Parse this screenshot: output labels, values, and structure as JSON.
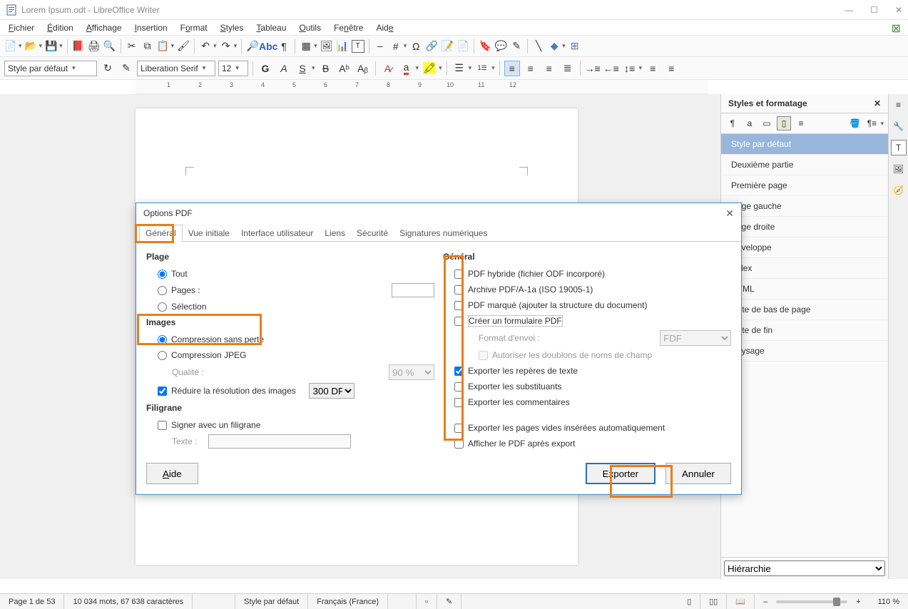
{
  "titlebar": {
    "title": "Lorem Ipsum.odt - LibreOffice Writer"
  },
  "menu": {
    "items": [
      "Fichier",
      "Édition",
      "Affichage",
      "Insertion",
      "Format",
      "Styles",
      "Tableau",
      "Outils",
      "Fenêtre",
      "Aide"
    ],
    "ul": [
      0,
      0,
      0,
      0,
      1,
      0,
      0,
      0,
      2,
      3
    ]
  },
  "style_combo": "Style par défaut",
  "font_combo": "Liberation Serif",
  "size_combo": "12",
  "ruler": {
    "nums": [
      1,
      2,
      3,
      4,
      5,
      6,
      7,
      8,
      9,
      10,
      11,
      12
    ]
  },
  "sidebar": {
    "title": "Styles et formatage",
    "items": [
      "Style par défaut",
      "Deuxième partie",
      "Première page",
      "Page gauche",
      "Page droite",
      "Enveloppe",
      "Index",
      "HTML",
      "Note de bas de page",
      "Note de fin",
      "Paysage"
    ],
    "selected": 0,
    "bottom": "Hiérarchie"
  },
  "dialog": {
    "title": "Options PDF",
    "tabs": [
      "Général",
      "Vue initiale",
      "Interface utilisateur",
      "Liens",
      "Sécurité",
      "Signatures numériques"
    ],
    "active_tab": 0,
    "plage": {
      "head": "Plage",
      "tout": "Tout",
      "pages": "Pages :",
      "selection": "Sélection",
      "selected": "tout",
      "pages_value": ""
    },
    "images": {
      "head": "Images",
      "lossless": "Compression sans perte",
      "jpeg": "Compression JPEG",
      "selected": "lossless",
      "quality_label": "Qualité :",
      "quality": "90 %",
      "reduce": "Réduire la résolution des images",
      "reduce_checked": true,
      "dpi": "300 DPI"
    },
    "filigrane": {
      "head": "Filigrane",
      "signer": "Signer avec un filigrane",
      "signer_checked": false,
      "texte_label": "Texte :",
      "texte": ""
    },
    "general": {
      "head": "Général",
      "hybrid": "PDF hybride (fichier ODF incorporé)",
      "hybrid_c": false,
      "pdfa": "Archive PDF/A-1a (ISO 19005-1)",
      "pdfa_c": false,
      "marque": "PDF marqué (ajouter la structure du document)",
      "marque_c": false,
      "form": "Créer un formulaire PDF",
      "form_c": false,
      "format_envoi_label": "Format d'envoi :",
      "format_envoi": "FDF",
      "doublons": "Autoriser les doublons de noms de champ",
      "doublons_c": false,
      "reperes": "Exporter les repères de texte",
      "reperes_c": true,
      "subst": "Exporter les substituants",
      "subst_c": false,
      "comm": "Exporter les commentaires",
      "comm_c": false,
      "vides": "Exporter les pages vides insérées automatiquement",
      "vides_c": false,
      "afficher": "Afficher le PDF après export",
      "afficher_c": false
    },
    "buttons": {
      "aide": "Aide",
      "exporter": "Exporter",
      "annuler": "Annuler"
    }
  },
  "status": {
    "page": "Page 1 de 53",
    "words": "10 034 mots, 67 638 caractères",
    "style": "Style par défaut",
    "lang": "Français (France)",
    "zoom": "110 %"
  }
}
